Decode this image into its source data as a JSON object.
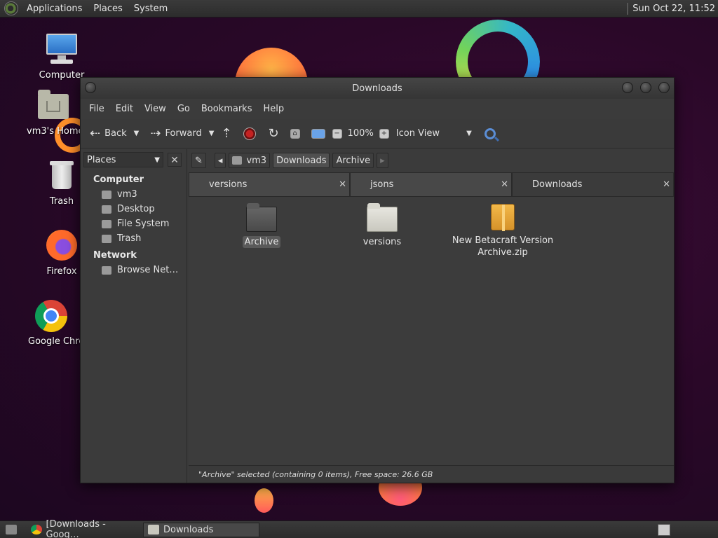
{
  "top_panel": {
    "applications": "Applications",
    "places": "Places",
    "system": "System",
    "clock": "Sun Oct 22, 11:52"
  },
  "desktop_icons": {
    "computer": "Computer",
    "home": "vm3's Home",
    "trash": "Trash",
    "firefox": "Firefox",
    "chrome": "Google Chrome"
  },
  "window": {
    "title": "Downloads",
    "menu": [
      "File",
      "Edit",
      "View",
      "Go",
      "Bookmarks",
      "Help"
    ],
    "toolbar": {
      "back": "Back",
      "forward": "Forward",
      "zoom": "100%",
      "view_mode": "Icon View"
    },
    "sidebar": {
      "selector": "Places",
      "sections": [
        {
          "title": "Computer",
          "items": [
            "vm3",
            "Desktop",
            "File System",
            "Trash"
          ]
        },
        {
          "title": "Network",
          "items": [
            "Browse Net…"
          ]
        }
      ]
    },
    "pathbar": [
      "vm3",
      "Downloads",
      "Archive"
    ],
    "tabs": [
      "versions",
      "jsons",
      "Downloads"
    ],
    "files": [
      {
        "name": "Archive",
        "kind": "folder-dark",
        "selected": true
      },
      {
        "name": "versions",
        "kind": "folder",
        "selected": false
      },
      {
        "name": "New Betacraft Version Archive.zip",
        "kind": "zip",
        "selected": false
      }
    ],
    "status": "\"Archive\" selected (containing 0 items), Free space: 26.6 GB"
  },
  "bottom_panel": {
    "tasks": [
      "[Downloads - Goog…",
      "Downloads"
    ]
  },
  "colors": {
    "desktop_bg": "#2a0828",
    "window_bg": "#3b3b3b",
    "accent_orange": "#ff7a3c"
  }
}
